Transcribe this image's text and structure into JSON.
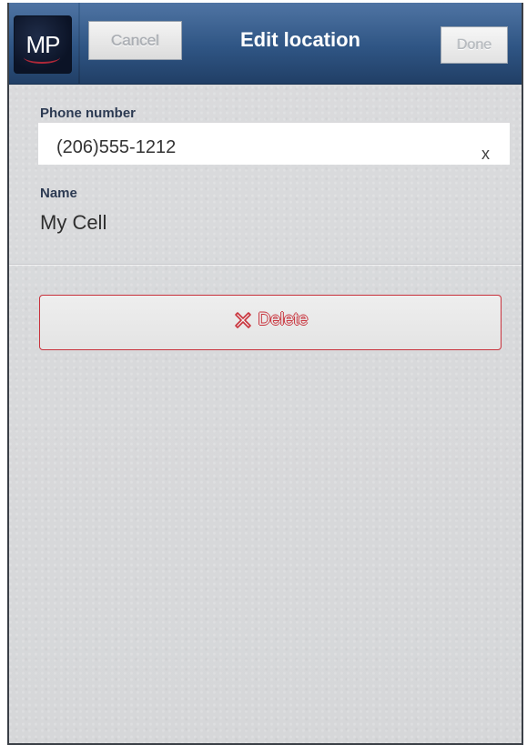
{
  "header": {
    "logo_text": "MP",
    "cancel_label": "Cancel",
    "title": "Edit location",
    "done_label": "Done"
  },
  "form": {
    "phone_label": "Phone number",
    "phone_value": "(206)555-1212",
    "phone_clear_label": "x",
    "name_label": "Name",
    "name_value": "My Cell"
  },
  "actions": {
    "delete_label": "Delete",
    "delete_icon": "x-circle-icon"
  },
  "colors": {
    "header_top": "#4f74a3",
    "header_bottom": "#213f66",
    "delete_accent": "#c8323c",
    "background": "#d9dadc"
  }
}
